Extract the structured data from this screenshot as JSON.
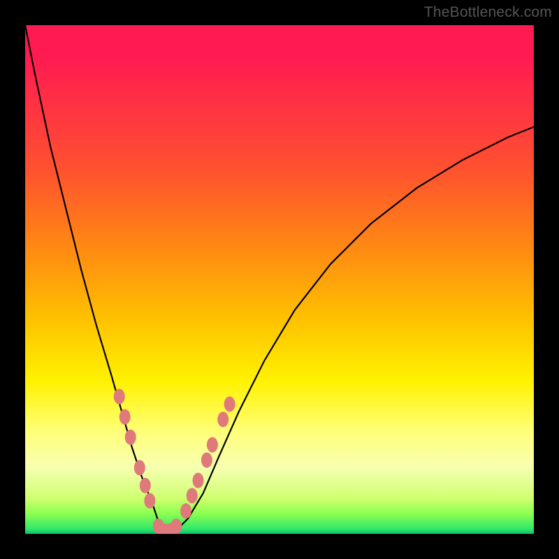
{
  "watermark": "TheBottleneck.com",
  "chart_data": {
    "type": "line",
    "title": "",
    "xlabel": "",
    "ylabel": "",
    "xlim": [
      0,
      100
    ],
    "ylim": [
      0,
      100
    ],
    "series": [
      {
        "name": "bottleneck-curve",
        "x": [
          0,
          2,
          5,
          8,
          11,
          14,
          17,
          19,
          21,
          23,
          25,
          26,
          27,
          28,
          30,
          32,
          35,
          38,
          42,
          47,
          53,
          60,
          68,
          77,
          86,
          95,
          100
        ],
        "values": [
          100,
          90,
          76,
          64,
          52,
          41,
          31,
          24,
          17,
          11,
          6,
          3,
          1,
          0.5,
          1,
          3,
          8,
          15,
          24,
          34,
          44,
          53,
          61,
          68,
          73.5,
          78,
          80
        ]
      }
    ],
    "markers": {
      "name": "highlight-dots",
      "color": "#e07a7a",
      "points": [
        {
          "x": 18.5,
          "y": 27
        },
        {
          "x": 19.6,
          "y": 23
        },
        {
          "x": 20.7,
          "y": 19
        },
        {
          "x": 22.5,
          "y": 13
        },
        {
          "x": 23.6,
          "y": 9.5
        },
        {
          "x": 24.5,
          "y": 6.5
        },
        {
          "x": 26.2,
          "y": 1.5
        },
        {
          "x": 27.3,
          "y": 0.6
        },
        {
          "x": 28.5,
          "y": 0.6
        },
        {
          "x": 29.7,
          "y": 1.5
        },
        {
          "x": 31.6,
          "y": 4.5
        },
        {
          "x": 32.8,
          "y": 7.5
        },
        {
          "x": 34.0,
          "y": 10.5
        },
        {
          "x": 35.7,
          "y": 14.5
        },
        {
          "x": 36.8,
          "y": 17.5
        },
        {
          "x": 38.9,
          "y": 22.5
        },
        {
          "x": 40.2,
          "y": 25.5
        }
      ]
    }
  }
}
